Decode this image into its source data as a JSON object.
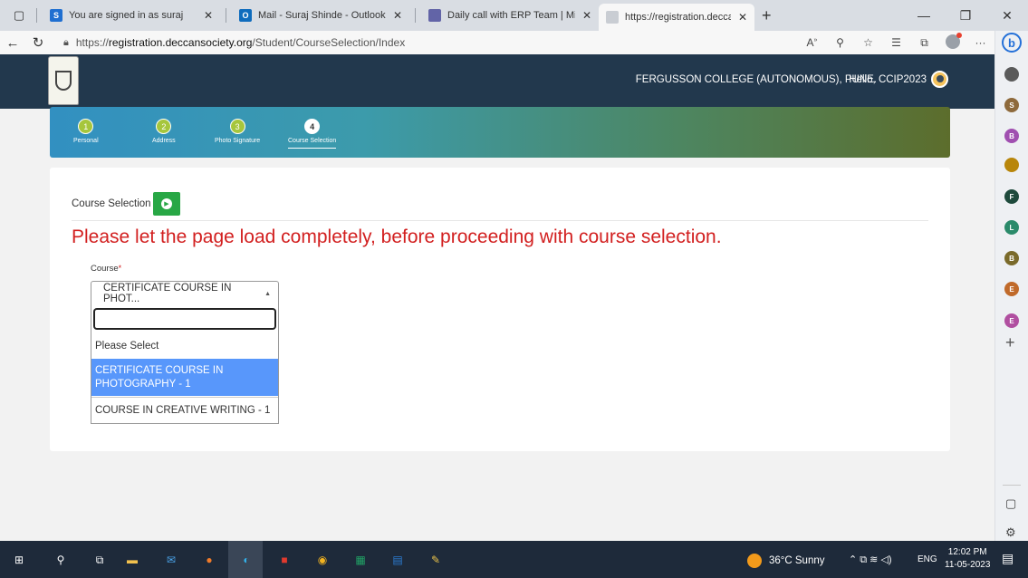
{
  "browser": {
    "tabs": [
      {
        "label": "You are signed in as suraj",
        "favicon_color": "#1f6fd1",
        "favicon_glyph": "S"
      },
      {
        "label": "Mail - Suraj Shinde - Outlook",
        "favicon_color": "#0f6cbd",
        "favicon_glyph": "O"
      },
      {
        "label": "Daily call with ERP Team | Micros",
        "favicon_color": "#6264a7",
        "favicon_glyph": ""
      },
      {
        "label": "https://registration.deccansociety",
        "favicon_color": "#c9cdd3",
        "favicon_glyph": ""
      }
    ],
    "url_prefix": "https://",
    "url_host": "registration.deccansociety.org",
    "url_path": "/Student/CourseSelection/Index"
  },
  "header": {
    "college": "FERGUSSON COLLEGE (AUTONOMOUS), PUNE.",
    "greeting": "Hello, CCIP2023"
  },
  "steps": [
    {
      "num": "1",
      "label": "Personal"
    },
    {
      "num": "2",
      "label": "Address"
    },
    {
      "num": "3",
      "label": "Photo Signature"
    },
    {
      "num": "4",
      "label": "Course Selection"
    }
  ],
  "main": {
    "section_title": "Course Selection",
    "warning": "Please let the page load completely, before proceeding with course selection.",
    "course_label": "Course",
    "required_mark": "*",
    "selected_value": "CERTIFICATE COURSE IN PHOT...",
    "dropdown_options": [
      "Please Select",
      "CERTIFICATE COURSE IN PHOTOGRAPHY - 1",
      "COURSE IN CREATIVE WRITING - 1"
    ],
    "selected_option_index": 1
  },
  "edge_sidebar": {
    "items": [
      {
        "glyph": "",
        "color": "#5a5a5a"
      },
      {
        "glyph": "S",
        "color": "#8e6a3c"
      },
      {
        "glyph": "B",
        "color": "#a04fb0"
      },
      {
        "glyph": "",
        "color": "#b8860b"
      },
      {
        "glyph": "F",
        "color": "#1e4a3c"
      },
      {
        "glyph": "L",
        "color": "#2a8a6a"
      },
      {
        "glyph": "B",
        "color": "#7a6a2a"
      },
      {
        "glyph": "E",
        "color": "#c06a2a"
      },
      {
        "glyph": "E",
        "color": "#b04fa0"
      }
    ]
  },
  "taskbar": {
    "weather": "36°C  Sunny",
    "language": "ENG",
    "time": "12:02 PM",
    "date": "11-05-2023"
  },
  "colors": {
    "header_bg": "#22384d",
    "warning": "#d21f1f",
    "selected_option": "#5897fb",
    "play_button": "#28a745"
  }
}
